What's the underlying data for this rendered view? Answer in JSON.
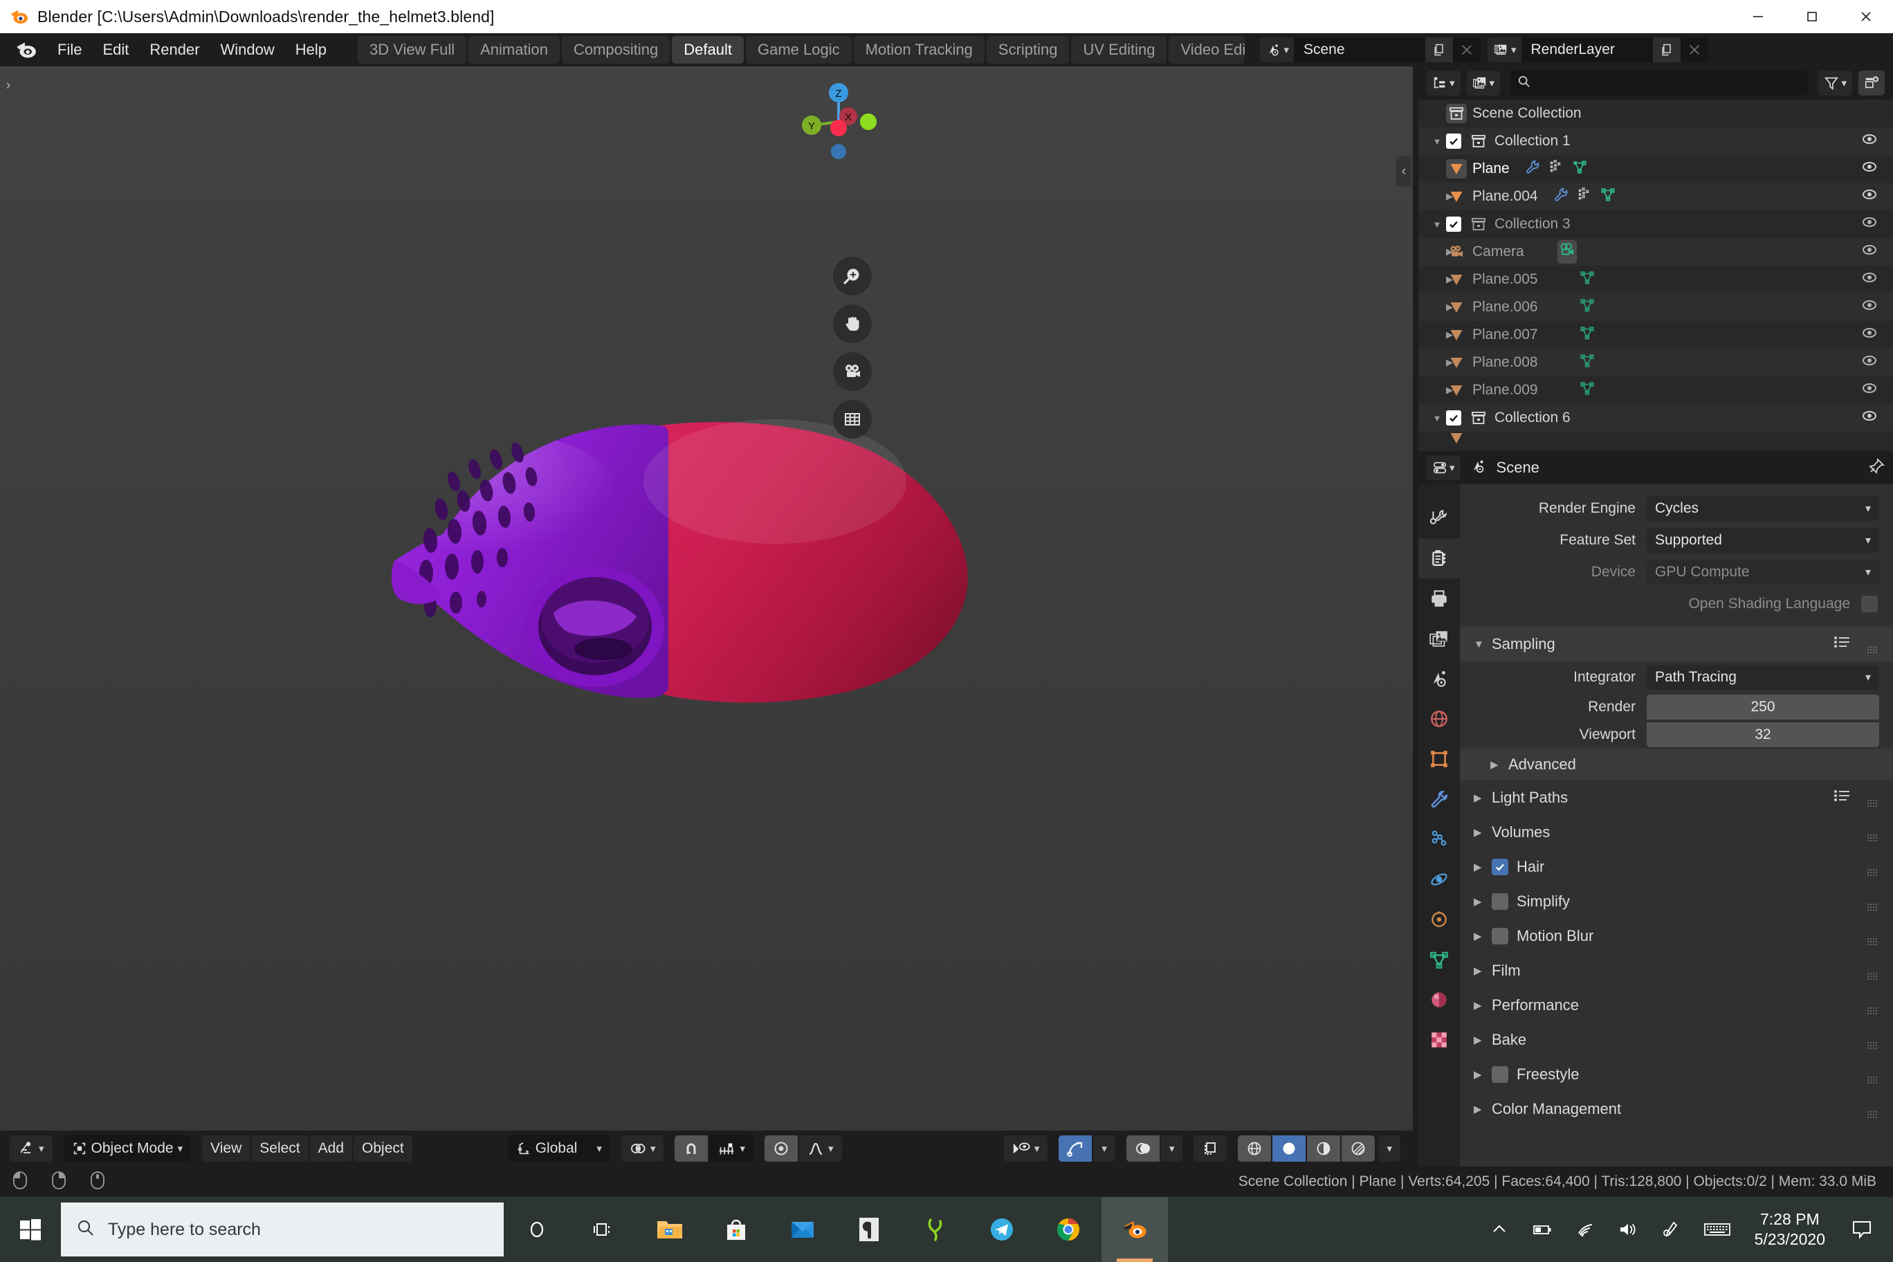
{
  "window": {
    "title": "Blender [C:\\Users\\Admin\\Downloads\\render_the_helmet3.blend]",
    "icon": "blender-logo-icon",
    "minimize": "minimize-icon",
    "maximize": "maximize-icon",
    "close": "close-icon"
  },
  "topbar": {
    "logo": "blender-logo-icon",
    "menus": [
      "File",
      "Edit",
      "Render",
      "Window",
      "Help"
    ],
    "screen_tabs": [
      {
        "label": "3D View Full",
        "active": false
      },
      {
        "label": "Animation",
        "active": false
      },
      {
        "label": "Compositing",
        "active": false
      },
      {
        "label": "Default",
        "active": true
      },
      {
        "label": "Game Logic",
        "active": false
      },
      {
        "label": "Motion Tracking",
        "active": false
      },
      {
        "label": "Scripting",
        "active": false
      },
      {
        "label": "UV Editing",
        "active": false
      },
      {
        "label": "Video Editing",
        "active": false
      }
    ],
    "scene": {
      "icon": "scene-icon",
      "name": "Scene",
      "new_btn": "new-scene-icon",
      "delete_btn": "unlink-scene-icon"
    },
    "view_layer": {
      "icon": "renderlayers-icon",
      "name": "RenderLayer",
      "new_btn": "new-viewlayer-icon",
      "delete_btn": "unlink-viewlayer-icon"
    }
  },
  "viewport": {
    "gizmo": {
      "axes": [
        "Z",
        "Y",
        "X"
      ],
      "z_color": "#3a9ae0",
      "y_color": "#7eb026",
      "x_color": "#c0394f",
      "neg_x_color": "#fa2d4e",
      "neg_y_color": "#8ede1f",
      "neg_z_color": "#3876b3"
    },
    "nav_buttons": [
      "zoom-icon",
      "pan-hand-icon",
      "camera-view-icon",
      "toggle-ortho-grid-icon"
    ],
    "collapse_sidebar": "chevron-left-icon",
    "toolbar_toggle": "chevron-right-icon",
    "object_color_left": "#8b1ed1",
    "object_color_right": "#cf1f52"
  },
  "viewport_footer": {
    "editor_type": "editor-type-3dview-icon",
    "mode_icon": "object-mode-icon",
    "mode": "Object Mode",
    "menus": [
      "View",
      "Select",
      "Add",
      "Object"
    ],
    "transform_orientation_icon": "orientation-icon",
    "transform_orientation": "Global",
    "pivot_icon": "pivot-point-icon",
    "snap_magnet_icon": "snap-magnet-icon",
    "snap_target_icon": "snap-increment-icon",
    "proportional_edit_icon": "proportional-edit-icon",
    "falloff_icon": "proportional-falloff-icon",
    "visibility_icon": "object-visibility-icon",
    "gizmo_icon": "show-gizmo-icon",
    "overlays_icon": "show-overlays-icon",
    "xray_icon": "toggle-xray-icon",
    "shading_modes": [
      "wireframe",
      "solid",
      "material-preview",
      "rendered"
    ],
    "shading_active": "solid"
  },
  "outliner": {
    "display_mode_icon": "outliner-display-mode-icon",
    "filter_id_icon": "outliner-id-type-icon",
    "search_icon": "search-icon",
    "search_value": "",
    "search_placeholder": "",
    "filter_icon": "filter-funnel-icon",
    "new_collection_icon": "new-collection-icon",
    "rows": [
      {
        "indent": 0,
        "label": "Scene Collection",
        "icon": "collection-icon",
        "disclosure": "",
        "checkbox": false,
        "eye": false,
        "dim": false,
        "selected": true,
        "extras": []
      },
      {
        "indent": 1,
        "label": "Collection 1",
        "icon": "collection-icon",
        "disclosure": "down",
        "checkbox": true,
        "eye": true,
        "dim": false,
        "selected": false,
        "extras": []
      },
      {
        "indent": 2,
        "label": "Plane",
        "icon": "mesh-object-icon",
        "disclosure": "right",
        "checkbox": false,
        "eye": true,
        "dim": false,
        "selected": true,
        "extras": [
          "modifier-wrench-icon",
          "particles-icon",
          "mesh-data-icon"
        ]
      },
      {
        "indent": 2,
        "label": "Plane.004",
        "icon": "mesh-object-icon",
        "disclosure": "right",
        "checkbox": false,
        "eye": true,
        "dim": false,
        "selected": false,
        "extras": [
          "modifier-wrench-icon",
          "particles-icon",
          "mesh-data-icon"
        ]
      },
      {
        "indent": 1,
        "label": "Collection 3",
        "icon": "collection-icon",
        "disclosure": "down",
        "checkbox": true,
        "eye": true,
        "dim": true,
        "selected": false,
        "extras": []
      },
      {
        "indent": 2,
        "label": "Camera",
        "icon": "camera-object-icon",
        "disclosure": "right",
        "checkbox": false,
        "eye": true,
        "dim": true,
        "selected": false,
        "extras": [
          "camera-data-icon"
        ]
      },
      {
        "indent": 2,
        "label": "Plane.005",
        "icon": "mesh-object-icon",
        "disclosure": "right",
        "checkbox": false,
        "eye": true,
        "dim": true,
        "selected": false,
        "extras": [
          "mesh-data-icon"
        ]
      },
      {
        "indent": 2,
        "label": "Plane.006",
        "icon": "mesh-object-icon",
        "disclosure": "right",
        "checkbox": false,
        "eye": true,
        "dim": true,
        "selected": false,
        "extras": [
          "mesh-data-icon"
        ]
      },
      {
        "indent": 2,
        "label": "Plane.007",
        "icon": "mesh-object-icon",
        "disclosure": "right",
        "checkbox": false,
        "eye": true,
        "dim": true,
        "selected": false,
        "extras": [
          "mesh-data-icon"
        ]
      },
      {
        "indent": 2,
        "label": "Plane.008",
        "icon": "mesh-object-icon",
        "disclosure": "right",
        "checkbox": false,
        "eye": true,
        "dim": true,
        "selected": false,
        "extras": [
          "mesh-data-icon"
        ]
      },
      {
        "indent": 2,
        "label": "Plane.009",
        "icon": "mesh-object-icon",
        "disclosure": "right",
        "checkbox": false,
        "eye": true,
        "dim": true,
        "selected": false,
        "extras": [
          "mesh-data-icon"
        ]
      },
      {
        "indent": 1,
        "label": "Collection 6",
        "icon": "collection-icon",
        "disclosure": "down",
        "checkbox": true,
        "eye": true,
        "dim": false,
        "selected": false,
        "extras": []
      }
    ]
  },
  "properties": {
    "editor_type_icon": "editor-type-properties-icon",
    "context_icon": "scene-properties-icon",
    "context_label": "Scene",
    "pin_icon": "pin-icon",
    "tabs": [
      {
        "name": "tool-tab",
        "icon": "tool-icon",
        "active": false
      },
      {
        "name": "render-tab",
        "icon": "render-camera-back-icon",
        "active": true
      },
      {
        "name": "output-tab",
        "icon": "printer-icon",
        "active": false
      },
      {
        "name": "view-layer-tab",
        "icon": "images-icon",
        "active": false
      },
      {
        "name": "scene-tab",
        "icon": "scene-cone-icon",
        "active": false
      },
      {
        "name": "world-tab",
        "icon": "world-globe-icon",
        "active": false
      },
      {
        "name": "object-tab",
        "icon": "object-square-icon",
        "active": false
      },
      {
        "name": "modifier-tab",
        "icon": "wrench-icon",
        "active": false
      },
      {
        "name": "particles-tab",
        "icon": "particles-icon",
        "active": false
      },
      {
        "name": "physics-tab",
        "icon": "physics-orbit-icon",
        "active": false
      },
      {
        "name": "constraints-tab",
        "icon": "constraint-icon",
        "active": false
      },
      {
        "name": "data-tab",
        "icon": "mesh-data-green-icon",
        "active": false
      },
      {
        "name": "material-tab",
        "icon": "material-sphere-icon",
        "active": false
      },
      {
        "name": "texture-tab",
        "icon": "texture-checker-icon",
        "active": false
      }
    ],
    "render_engine": {
      "label": "Render Engine",
      "value": "Cycles"
    },
    "feature_set": {
      "label": "Feature Set",
      "value": "Supported"
    },
    "device": {
      "label": "Device",
      "value": "GPU Compute",
      "disabled": true
    },
    "osl": {
      "label": "Open Shading Language",
      "checked": false,
      "disabled": true
    },
    "sampling": {
      "title": "Sampling",
      "expanded": true,
      "integrator": {
        "label": "Integrator",
        "value": "Path Tracing"
      },
      "render": {
        "label": "Render",
        "value": "250"
      },
      "viewport": {
        "label": "Viewport",
        "value": "32"
      },
      "advanced": {
        "label": "Advanced",
        "expanded": false
      }
    },
    "sections": [
      {
        "label": "Light Paths",
        "expanded": false,
        "checkbox": null,
        "preset": true
      },
      {
        "label": "Volumes",
        "expanded": false,
        "checkbox": null,
        "preset": false
      },
      {
        "label": "Hair",
        "expanded": false,
        "checkbox": true,
        "preset": false
      },
      {
        "label": "Simplify",
        "expanded": false,
        "checkbox": false,
        "preset": false
      },
      {
        "label": "Motion Blur",
        "expanded": false,
        "checkbox": false,
        "preset": false
      },
      {
        "label": "Film",
        "expanded": false,
        "checkbox": null,
        "preset": false
      },
      {
        "label": "Performance",
        "expanded": false,
        "checkbox": null,
        "preset": false
      },
      {
        "label": "Bake",
        "expanded": false,
        "checkbox": null,
        "preset": false
      },
      {
        "label": "Freestyle",
        "expanded": false,
        "checkbox": false,
        "preset": false
      },
      {
        "label": "Color Management",
        "expanded": false,
        "checkbox": null,
        "preset": false
      }
    ]
  },
  "statusbar": {
    "keymap": [
      "mouse-left-icon",
      "mouse-right-icon",
      "mouse-middle-icon"
    ],
    "info": "Scene Collection | Plane | Verts:64,205 | Faces:64,400 | Tris:128,800 | Objects:0/2 | Mem: 33.0 MiB"
  },
  "taskbar": {
    "start": "windows-start-icon",
    "search_icon": "search-icon",
    "search_placeholder": "Type here to search",
    "search_value": "",
    "items": [
      {
        "name": "cortana-icon"
      },
      {
        "name": "task-view-icon"
      },
      {
        "name": "file-explorer-icon"
      },
      {
        "name": "microsoft-store-icon"
      },
      {
        "name": "mail-icon"
      },
      {
        "name": "adobe-app-icon"
      },
      {
        "name": "calibre-icon"
      },
      {
        "name": "telegram-icon"
      },
      {
        "name": "google-chrome-icon"
      },
      {
        "name": "blender-icon"
      }
    ],
    "tray": [
      "show-hidden-icons-icon",
      "battery-icon",
      "wifi-icon",
      "volume-icon",
      "pen-icon",
      "touch-keyboard-icon"
    ],
    "time": "7:28 PM",
    "date": "5/23/2020",
    "notifications": "action-center-icon"
  }
}
